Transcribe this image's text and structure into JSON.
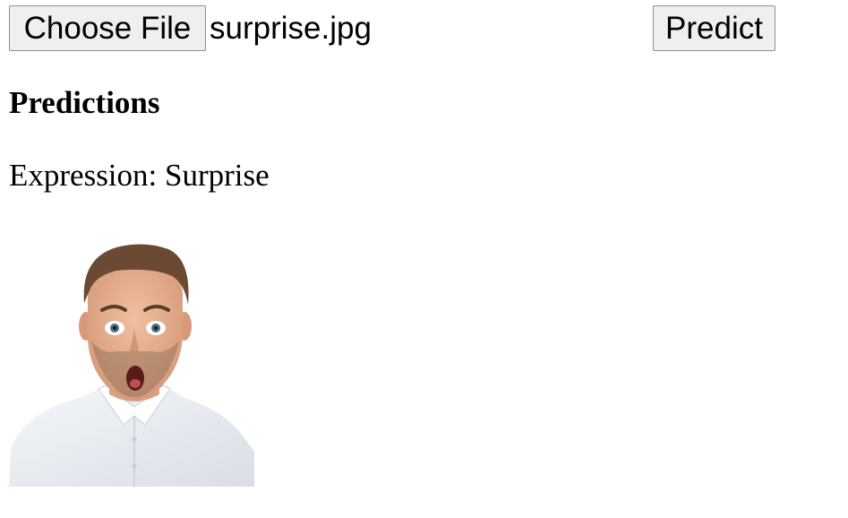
{
  "file_input": {
    "button_label": "Choose File",
    "selected_file": "surprise.jpg"
  },
  "predict_button": {
    "label": "Predict"
  },
  "predictions": {
    "heading": "Predictions",
    "expression_label": "Expression:",
    "expression_value": "Surprise"
  },
  "image": {
    "subject": "surprised man with open mouth, white shirt"
  }
}
